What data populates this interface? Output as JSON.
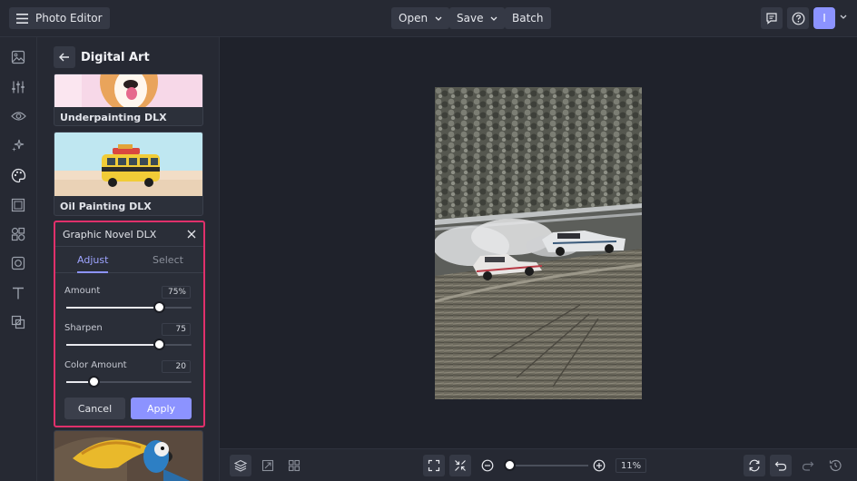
{
  "app": {
    "title": "Photo Editor"
  },
  "topbar": {
    "open_label": "Open",
    "save_label": "Save",
    "batch_label": "Batch",
    "avatar_initial": "I"
  },
  "panel": {
    "title": "Digital Art",
    "cards": [
      {
        "label": "Underpainting DLX"
      },
      {
        "label": "Oil Painting DLX"
      }
    ],
    "editor": {
      "title": "Graphic Novel DLX",
      "tabs": [
        {
          "label": "Adjust",
          "active": true
        },
        {
          "label": "Select",
          "active": false
        }
      ],
      "sliders": [
        {
          "label": "Amount",
          "value_text": "75%",
          "fraction": 0.74
        },
        {
          "label": "Sharpen",
          "value_text": "75",
          "fraction": 0.74
        },
        {
          "label": "Color Amount",
          "value_text": "20",
          "fraction": 0.22
        }
      ],
      "cancel_label": "Cancel",
      "apply_label": "Apply"
    }
  },
  "bottombar": {
    "zoom_text": "11%",
    "zoom_fraction": 0.03
  },
  "colors": {
    "accent": "#8c93ff",
    "highlight": "#e0306b",
    "panel": "#262933",
    "canvas": "#1f222b"
  },
  "icons": [
    "menu-icon",
    "chevron-down-icon",
    "chat-icon",
    "help-icon",
    "image-icon",
    "sliders-icon",
    "eye-icon",
    "sparkle-icon",
    "palette-icon",
    "frame-icon",
    "shapes-icon",
    "texture-icon",
    "text-icon",
    "overlay-icon",
    "arrow-left-icon",
    "close-icon",
    "layers-icon",
    "resize-icon",
    "grid-icon",
    "fit-icon",
    "actual-size-icon",
    "zoom-out-icon",
    "zoom-in-icon",
    "refresh-icon",
    "undo-icon",
    "redo-icon",
    "history-icon"
  ]
}
